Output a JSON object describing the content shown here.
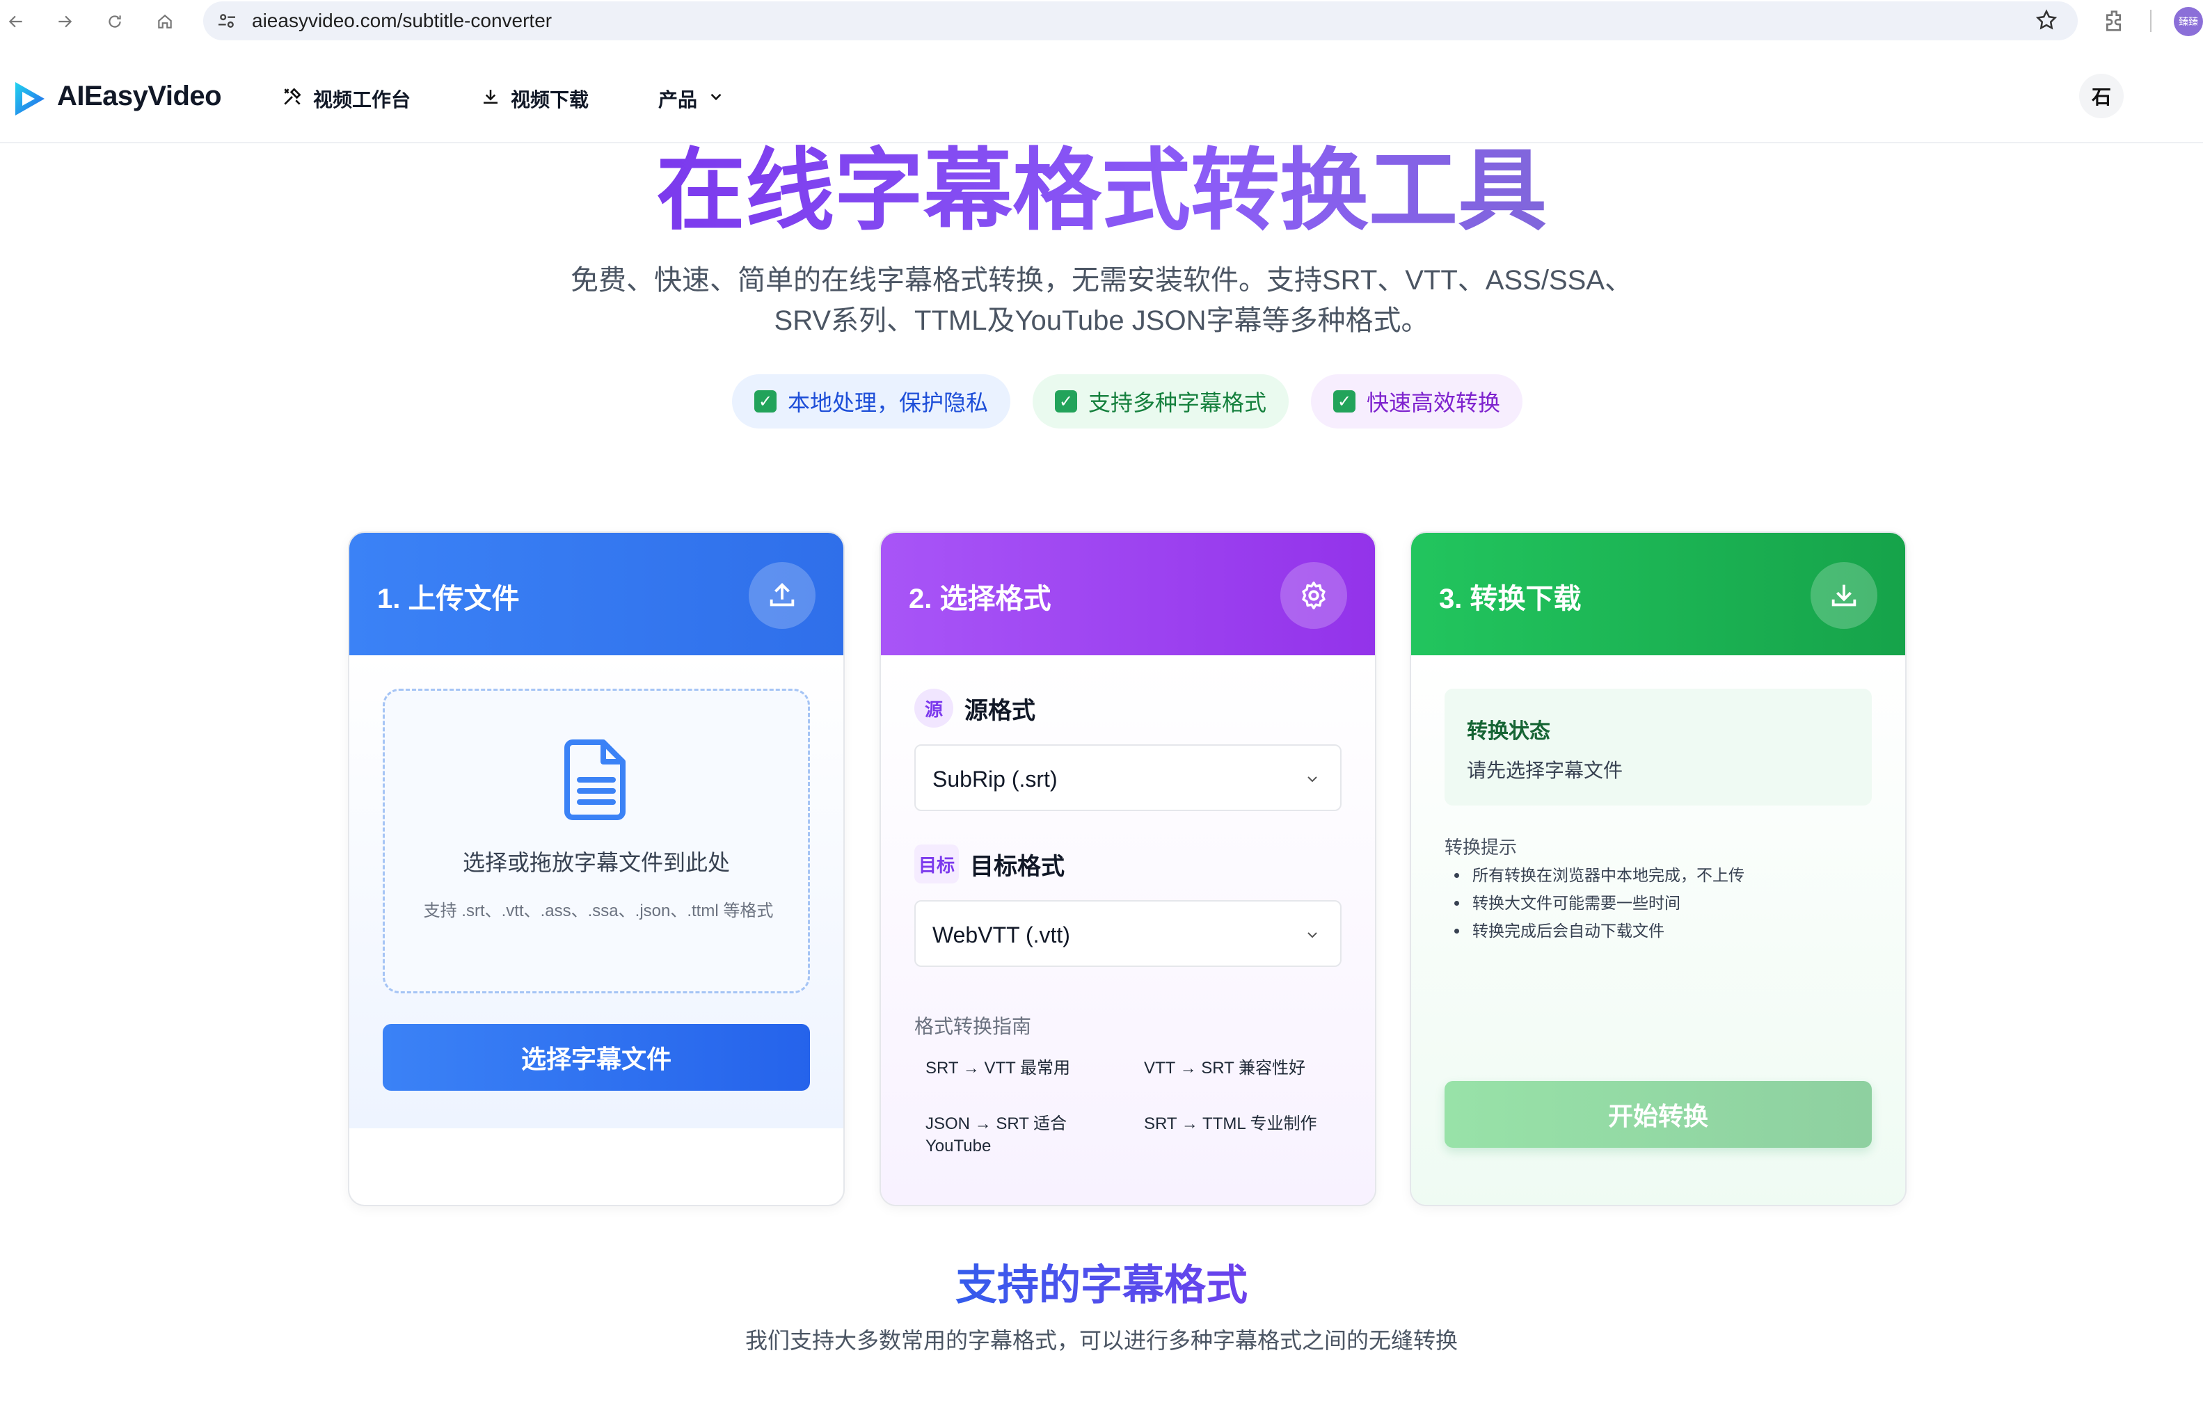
{
  "browser": {
    "url": "aieasyvideo.com/subtitle-converter",
    "profile_label": "臻臻"
  },
  "header": {
    "logo_text": "AIEasyVideo",
    "nav": [
      {
        "label": "视频工作台"
      },
      {
        "label": "视频下载"
      },
      {
        "label": "产品"
      }
    ],
    "user_initial": "石"
  },
  "hero": {
    "title": "在线字幕格式转换工具",
    "subtitle_line1": "免费、快速、简单的在线字幕格式转换，无需安装软件。支持SRT、VTT、ASS/SSA、",
    "subtitle_line2": "SRV系列、TTML及YouTube JSON字幕等多种格式。",
    "badges": [
      {
        "label": "本地处理，保护隐私",
        "color": "#1d4ed8"
      },
      {
        "label": "支持多种字幕格式",
        "color": "#15803d"
      },
      {
        "label": "快速高效转换",
        "color": "#7e22ce"
      }
    ]
  },
  "steps": {
    "upload": {
      "title": "1. 上传文件",
      "drop_text": "选择或拖放字幕文件到此处",
      "drop_hint": "支持 .srt、.vtt、.ass、.ssa、.json、.ttml 等格式",
      "button_label": "选择字幕文件"
    },
    "format": {
      "title": "2. 选择格式",
      "source_tag": "源",
      "source_label": "源格式",
      "source_value": "SubRip (.srt)",
      "target_tag": "目标",
      "target_label": "目标格式",
      "target_value": "WebVTT (.vtt)",
      "guide_title": "格式转换指南",
      "guide_items": [
        "SRT → VTT 最常用",
        "VTT → SRT 兼容性好",
        "JSON → SRT 适合YouTube",
        "SRT → TTML 专业制作"
      ]
    },
    "convert": {
      "title": "3. 转换下载",
      "status_title": "转换状态",
      "status_text": "请先选择字幕文件",
      "tips_title": "转换提示",
      "tips": [
        "所有转换在浏览器中本地完成，不上传",
        "转换大文件可能需要一些时间",
        "转换完成后会自动下载文件"
      ],
      "button_label": "开始转换"
    }
  },
  "supported": {
    "title": "支持的字幕格式",
    "subtitle": "我们支持大多数常用的字幕格式，可以进行多种字幕格式之间的无缝转换"
  },
  "colors": {
    "upload_header": "#3b82f6",
    "format_header": "#a855f7",
    "convert_header": "#22c55e"
  }
}
